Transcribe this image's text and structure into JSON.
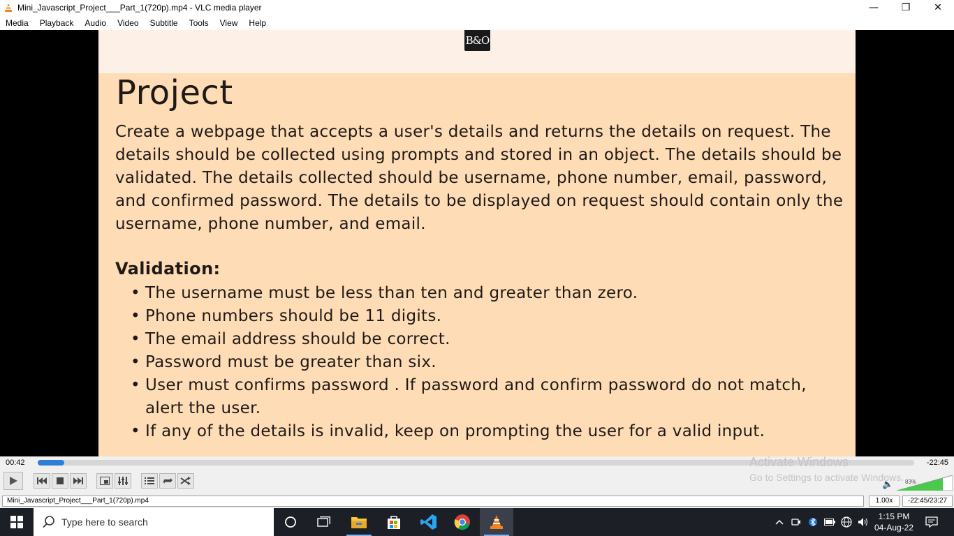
{
  "window": {
    "title": "Mini_Javascript_Project___Part_1(720p).mp4 - VLC media player",
    "minimize": "—",
    "restore": "❐",
    "close": "✕"
  },
  "menu": {
    "items": [
      "Media",
      "Playback",
      "Audio",
      "Video",
      "Subtitle",
      "Tools",
      "View",
      "Help"
    ]
  },
  "slide": {
    "logo": "B&O",
    "heading": "Project",
    "paragraph": "Create a webpage that accepts a user's details and returns the details on request. The details should be collected using prompts and stored in an object. The details should be validated. The details collected should be username, phone number, email, password, and confirmed password. The details to be displayed on request should contain only the username, phone number, and email.",
    "validation_heading": "Validation:",
    "rules": [
      "The username must be less than ten and greater than zero.",
      "Phone numbers should be 11 digits.",
      "The email address should be correct.",
      "Password must be greater than six.",
      "User must confirms password .  If password and confirm password do not match, alert the user.",
      "If any of the details is invalid, keep on prompting the user for a valid input."
    ]
  },
  "player": {
    "elapsed": "00:42",
    "remaining": "-22:45",
    "progress_fraction": 0.03,
    "volume_label": "83%",
    "volume_fraction": 0.83
  },
  "watermark": {
    "line1": "Activate Windows",
    "line2": "Go to Settings to activate Windows."
  },
  "status": {
    "filename": "Mini_Javascript_Project___Part_1(720p).mp4",
    "speed": "1.00x",
    "time": "-22:45/23:27"
  },
  "taskbar": {
    "search_placeholder": "Type here to search",
    "time": "1:15 PM",
    "date": "04-Aug-22"
  },
  "colors": {
    "accent": "#2e7dd8",
    "slide_bg": "#fedcb6",
    "taskbar_bg": "#1c1f26"
  }
}
